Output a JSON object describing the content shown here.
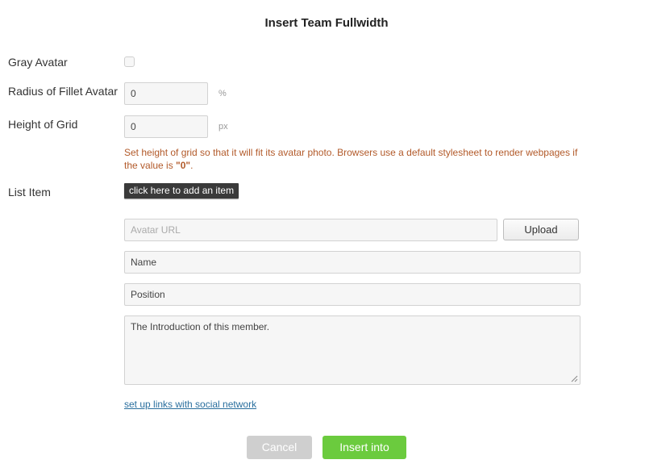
{
  "dialog": {
    "title": "Insert Team Fullwidth"
  },
  "form": {
    "gray_avatar": {
      "label": "Gray Avatar",
      "checked": false
    },
    "radius": {
      "label": "Radius of Fillet Avatar",
      "value": "0",
      "unit": "%"
    },
    "height": {
      "label": "Height of Grid",
      "value": "0",
      "unit": "px",
      "hint_text": "Set height of grid so that it will fit its avatar photo. Browsers use a default stylesheet to render webpages if the value is ",
      "hint_value": "\"0\"",
      "hint_end": "."
    },
    "list_item": {
      "label": "List Item",
      "add_button": "click here to add an item",
      "avatar_url_placeholder": "Avatar URL",
      "upload_button": "Upload",
      "name_value": "Name",
      "position_value": "Position",
      "intro_value": "The Introduction of this member.",
      "social_link": "set up links with social network"
    }
  },
  "footer": {
    "cancel_label": "Cancel",
    "insert_label": "Insert into"
  },
  "colors": {
    "hint": "#b25a2a",
    "insert_button": "#6bcb3e",
    "cancel_button": "#cfcfcf",
    "link": "#2a6f9e"
  },
  "icons": {
    "resize": "resize-grip-icon"
  }
}
